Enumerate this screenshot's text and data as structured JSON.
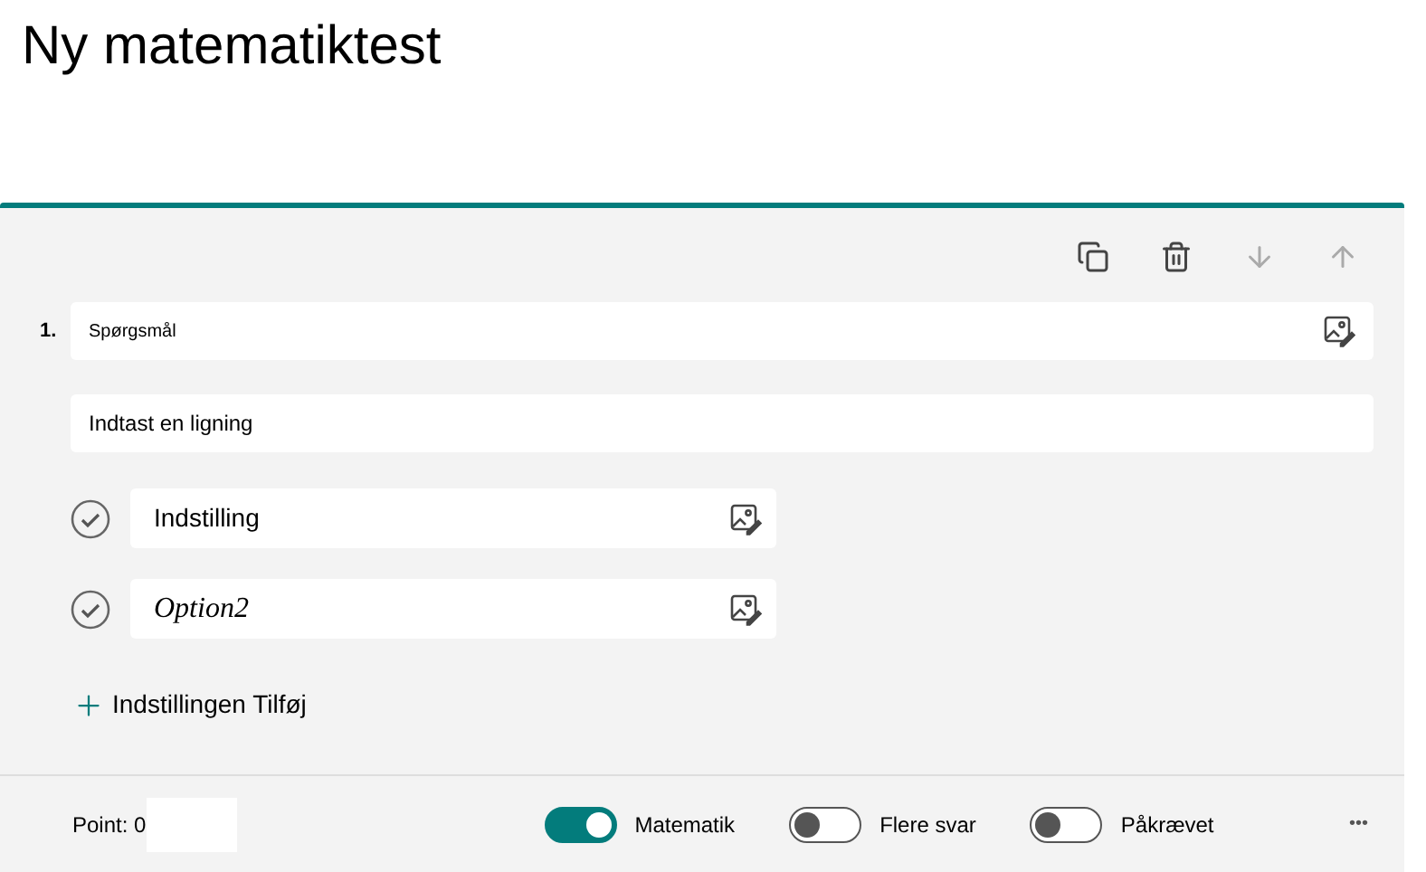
{
  "title": "Ny matematiktest",
  "question": {
    "number": "1.",
    "text": "Spørgsmål",
    "equation_placeholder": "Indtast en ligning"
  },
  "options": [
    {
      "kind": "text",
      "text": "Indstilling"
    },
    {
      "kind": "math",
      "text": "Option2"
    }
  ],
  "add_option": "Indstillingen Tilføj",
  "footer": {
    "points_label": "Point: 0",
    "toggles": [
      {
        "label": "Matematik",
        "on": true
      },
      {
        "label": "Flere svar",
        "on": false
      },
      {
        "label": "Påkrævet",
        "on": false
      }
    ],
    "more": "•••"
  }
}
